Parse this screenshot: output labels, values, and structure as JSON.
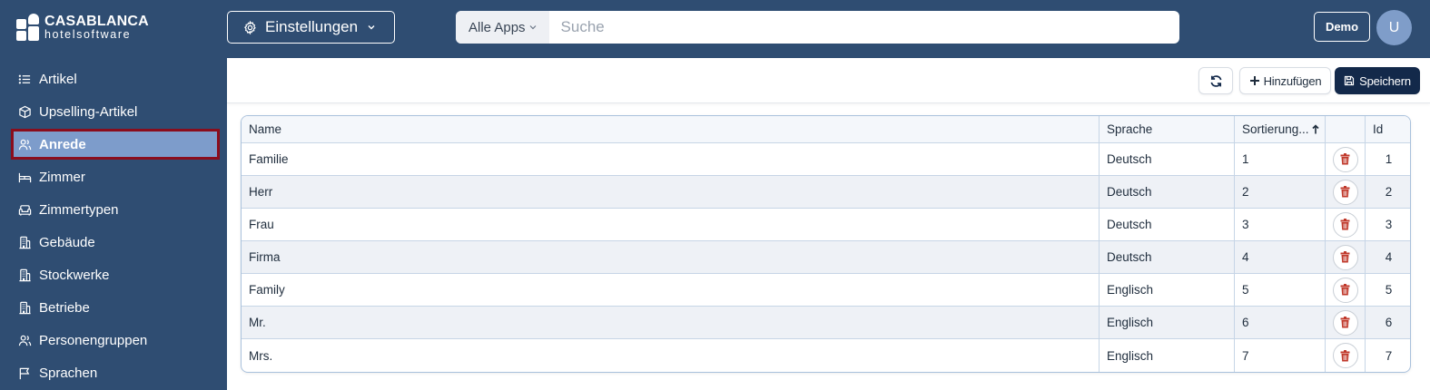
{
  "header": {
    "logo_line1": "CASABLANCA",
    "logo_line2": "hotelsoftware",
    "settings_label": "Einstellungen",
    "search_scope": "Alle Apps",
    "search_placeholder": "Suche",
    "demo_label": "Demo",
    "avatar_initial": "U"
  },
  "sidebar": {
    "items": [
      {
        "label": "Artikel",
        "icon": "list-icon"
      },
      {
        "label": "Upselling-Artikel",
        "icon": "box-icon"
      },
      {
        "label": "Anrede",
        "icon": "users-icon",
        "active": true
      },
      {
        "label": "Zimmer",
        "icon": "bed-icon"
      },
      {
        "label": "Zimmertypen",
        "icon": "sofa-icon"
      },
      {
        "label": "Gebäude",
        "icon": "building-icon"
      },
      {
        "label": "Stockwerke",
        "icon": "building-icon"
      },
      {
        "label": "Betriebe",
        "icon": "building-icon"
      },
      {
        "label": "Personengruppen",
        "icon": "users-icon"
      },
      {
        "label": "Sprachen",
        "icon": "flag-icon"
      }
    ]
  },
  "toolbar": {
    "add_label": "Hinzufügen",
    "save_label": "Speichern"
  },
  "table": {
    "columns": [
      "Name",
      "Sprache",
      "Sortierung...",
      "",
      "Id"
    ],
    "sort_column": "Sortierung...",
    "rows": [
      {
        "name": "Familie",
        "language": "Deutsch",
        "sort": "1",
        "id": "1"
      },
      {
        "name": "Herr",
        "language": "Deutsch",
        "sort": "2",
        "id": "2"
      },
      {
        "name": "Frau",
        "language": "Deutsch",
        "sort": "3",
        "id": "3"
      },
      {
        "name": "Firma",
        "language": "Deutsch",
        "sort": "4",
        "id": "4"
      },
      {
        "name": "Family",
        "language": "Englisch",
        "sort": "5",
        "id": "5"
      },
      {
        "name": "Mr.",
        "language": "Englisch",
        "sort": "6",
        "id": "6"
      },
      {
        "name": "Mrs.",
        "language": "Englisch",
        "sort": "7",
        "id": "7"
      }
    ]
  },
  "colors": {
    "navy": "#2f4d72",
    "active_item": "#7d9ccb",
    "active_border": "#8a0d1d",
    "save_button": "#13294a",
    "delete_icon": "#c0392b"
  }
}
